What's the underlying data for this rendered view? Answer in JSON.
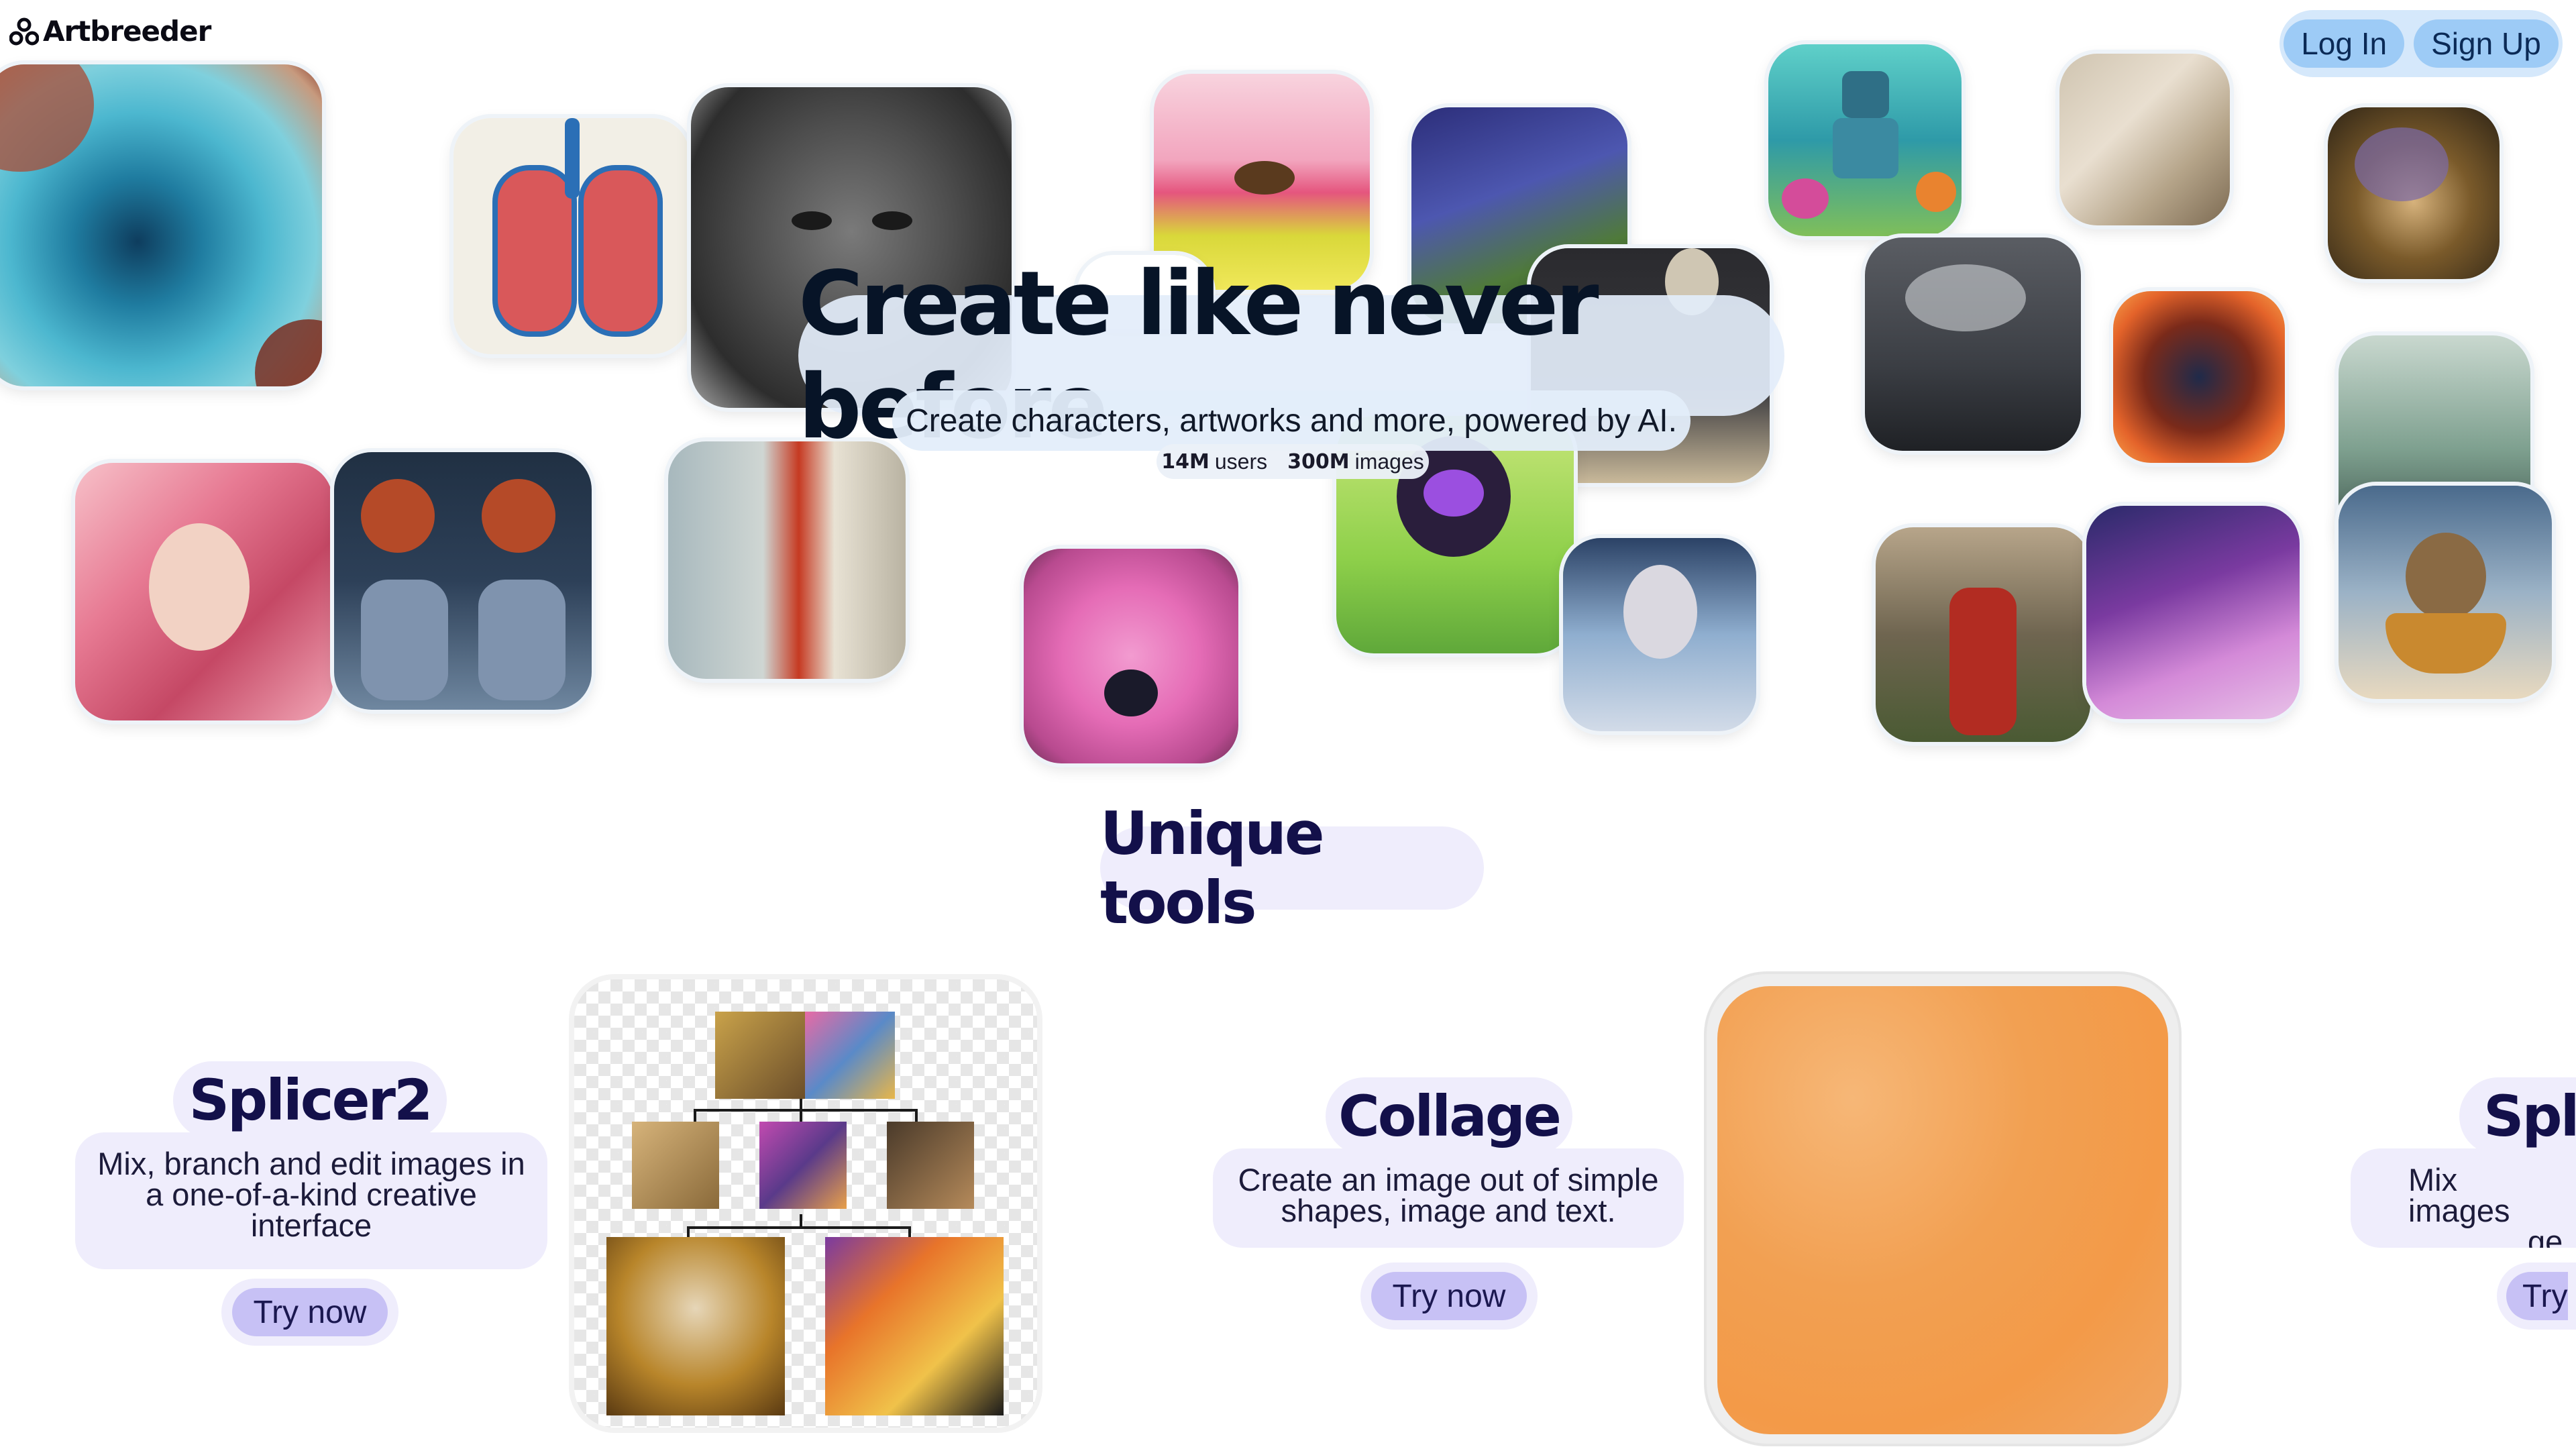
{
  "header": {
    "logo_text": "Artbreeder",
    "login_label": "Log In",
    "signup_label": "Sign Up"
  },
  "hero": {
    "title": "Create like never before",
    "subtitle": "Create characters, artworks and more, powered by AI.",
    "stats": {
      "users_value": "14M",
      "users_label": "users",
      "images_value": "300M",
      "images_label": "images"
    }
  },
  "tools_section": {
    "title": "Unique tools",
    "cards": [
      {
        "name": "Splicer2",
        "description": "Mix, branch and edit images in a one-of-a-kind creative interface",
        "cta": "Try now"
      },
      {
        "name": "Collage",
        "description": "Create an image out of simple shapes, image and text.",
        "cta": "Try now"
      },
      {
        "name": "Spl",
        "description_line1": "Mix images",
        "description_line2": "ge",
        "cta": "Try"
      }
    ]
  },
  "colors": {
    "accent_blue": "#9dcbf6",
    "pill_lavender": "#efedfc",
    "button_lavender": "#c7c1f5",
    "collage_orange": "#f39a48"
  }
}
